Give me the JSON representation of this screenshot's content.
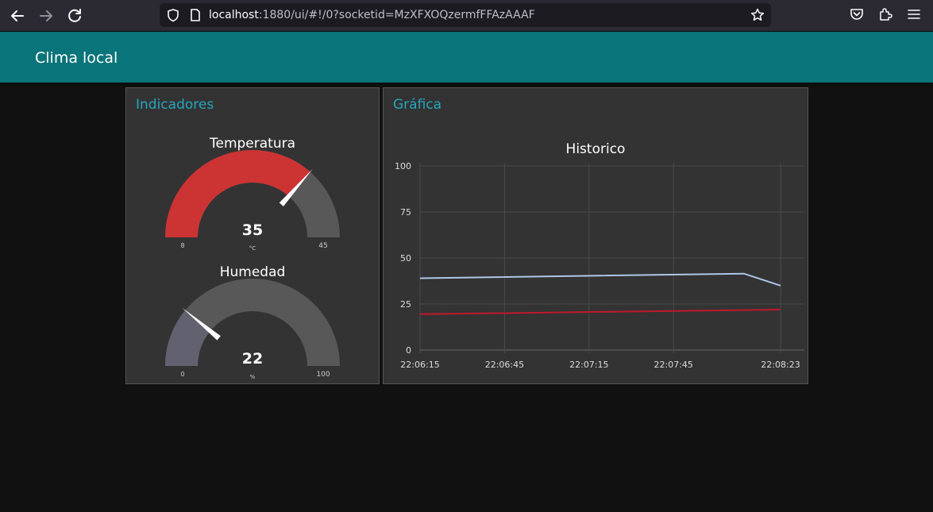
{
  "browser": {
    "url_host": "localhost",
    "url_path": ":1880/ui/#!/0?socketid=MzXFXOQzermfFFAzAAAF"
  },
  "dashboard": {
    "title": "Clima local"
  },
  "indicadores": {
    "title": "Indicadores",
    "gauges": [
      {
        "label": "Temperatura",
        "value": 35,
        "value_text": "35",
        "units": "°C",
        "min": 8,
        "min_text": "8",
        "max": 45,
        "max_text": "45",
        "color": "#cc3333"
      },
      {
        "label": "Humedad",
        "value": 22,
        "value_text": "22",
        "units": "%",
        "min": 0,
        "min_text": "0",
        "max": 100,
        "max_text": "100",
        "color": "#626170"
      }
    ]
  },
  "grafica": {
    "title": "Gráfica"
  },
  "chart_data": {
    "type": "line",
    "title": "Historico",
    "ylim": [
      0,
      100
    ],
    "yticks": [
      "0",
      "25",
      "50",
      "75",
      "100"
    ],
    "xticks": [
      "22:06:15",
      "22:06:45",
      "22:07:15",
      "22:07:45",
      "22:08:23"
    ],
    "grid": true,
    "series": [
      {
        "color": "#aec7e8",
        "x": [
          "22:06:15",
          "22:08:10",
          "22:08:23"
        ],
        "y": [
          39,
          41.5,
          35
        ]
      },
      {
        "color": "#c0182b",
        "x": [
          "22:06:15",
          "22:08:23"
        ],
        "y": [
          19.5,
          22
        ]
      }
    ]
  }
}
